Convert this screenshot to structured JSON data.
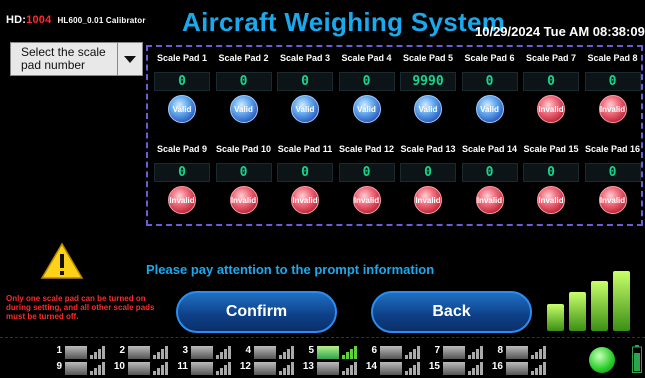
{
  "header": {
    "hd_label": "HD:",
    "hd_code": "1004",
    "version": "HL600_0.01 Calibrator",
    "title": "Aircraft Weighing System",
    "datetime": "10/29/2024 Tue AM 08:38:09"
  },
  "select": {
    "label": "Select the scale pad number"
  },
  "pads_row1": [
    {
      "name": "Scale Pad 1",
      "value": "0",
      "status": "Valid"
    },
    {
      "name": "Scale Pad 2",
      "value": "0",
      "status": "Valid"
    },
    {
      "name": "Scale Pad 3",
      "value": "0",
      "status": "Valid"
    },
    {
      "name": "Scale Pad 4",
      "value": "0",
      "status": "Valid"
    },
    {
      "name": "Scale Pad 5",
      "value": "9990",
      "status": "Valid"
    },
    {
      "name": "Scale Pad 6",
      "value": "0",
      "status": "Valid"
    },
    {
      "name": "Scale Pad 7",
      "value": "0",
      "status": "Invalid"
    },
    {
      "name": "Scale Pad 8",
      "value": "0",
      "status": "Invalid"
    }
  ],
  "pads_row2": [
    {
      "name": "Scale Pad 9",
      "value": "0",
      "status": "Invalid"
    },
    {
      "name": "Scale Pad 10",
      "value": "0",
      "status": "Invalid"
    },
    {
      "name": "Scale Pad 11",
      "value": "0",
      "status": "Invalid"
    },
    {
      "name": "Scale Pad 12",
      "value": "0",
      "status": "Invalid"
    },
    {
      "name": "Scale Pad 13",
      "value": "0",
      "status": "Invalid"
    },
    {
      "name": "Scale Pad 14",
      "value": "0",
      "status": "Invalid"
    },
    {
      "name": "Scale Pad 15",
      "value": "0",
      "status": "Invalid"
    },
    {
      "name": "Scale Pad 16",
      "value": "0",
      "status": "Invalid"
    }
  ],
  "prompt": "Please pay attention to the prompt information",
  "note": "Only one scale pad can be turned on during setting, and all other scale pads must be turned off.",
  "buttons": {
    "confirm": "Confirm",
    "back": "Back"
  },
  "channels_top": [
    "1",
    "2",
    "3",
    "4",
    "5",
    "6",
    "7",
    "8"
  ],
  "channels_bottom": [
    "9",
    "10",
    "11",
    "12",
    "13",
    "14",
    "15",
    "16"
  ],
  "active_channel": "5",
  "colors": {
    "accent": "#1ba9ee",
    "warning_text": "#ff2a2a",
    "value_text": "#18d48a",
    "frame": "#6a5bd6"
  }
}
